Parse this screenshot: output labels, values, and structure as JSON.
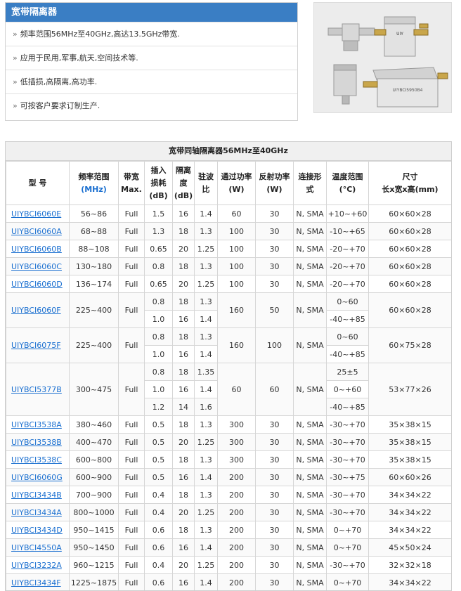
{
  "panel": {
    "title": "宽带隔离器",
    "features": [
      "频率范围56MHz至40GHz,高达13.5GHz带宽.",
      "应用于民用,军事,航天,空间技术等.",
      "低插损,高隔离,高功率.",
      "可按客户要求订制生产."
    ]
  },
  "table": {
    "title": "宽带同轴隔离器56MHz至40GHz",
    "headers": {
      "model": "型 号",
      "freq_a": "频率范围",
      "freq_b": "(MHz)",
      "bw_a": "带宽",
      "bw_b": "Max.",
      "il_a": "插入",
      "il_b": "损耗",
      "il_c": "(dB)",
      "iso_a": "隔离",
      "iso_b": "度",
      "iso_c": "(dB)",
      "vswr_a": "驻波",
      "vswr_b": "比",
      "fwd_a": "通过功率",
      "fwd_b": "(W)",
      "rev_a": "反射功率",
      "rev_b": "(W)",
      "conn_a": "连接形",
      "conn_b": "式",
      "temp_a": "温度范围",
      "temp_b": "(°C)",
      "size_a": "尺寸",
      "size_b": "长x宽x高(mm)"
    },
    "rows": [
      {
        "model": "UIYBCI6060E",
        "freq": "56~86",
        "bw": "Full",
        "il": "1.5",
        "iso": "16",
        "vswr": "1.4",
        "fwd": "60",
        "rev": "30",
        "conn": "N, SMA",
        "temp": "+10~+60",
        "size": "60×60×28"
      },
      {
        "model": "UIYBCI6060A",
        "freq": "68~88",
        "bw": "Full",
        "il": "1.3",
        "iso": "18",
        "vswr": "1.3",
        "fwd": "100",
        "rev": "30",
        "conn": "N, SMA",
        "temp": "-10~+65",
        "size": "60×60×28"
      },
      {
        "model": "UIYBCI6060B",
        "freq": "88~108",
        "bw": "Full",
        "il": "0.65",
        "iso": "20",
        "vswr": "1.25",
        "fwd": "100",
        "rev": "30",
        "conn": "N, SMA",
        "temp": "-20~+70",
        "size": "60×60×28"
      },
      {
        "model": "UIYBCI6060C",
        "freq": "130~180",
        "bw": "Full",
        "il": "0.8",
        "iso": "18",
        "vswr": "1.3",
        "fwd": "100",
        "rev": "30",
        "conn": "N, SMA",
        "temp": "-20~+70",
        "size": "60×60×28"
      },
      {
        "model": "UIYBCI6060D",
        "freq": "136~174",
        "bw": "Full",
        "il": "0.65",
        "iso": "20",
        "vswr": "1.25",
        "fwd": "100",
        "rev": "30",
        "conn": "N, SMA",
        "temp": "-20~+70",
        "size": "60×60×28"
      }
    ],
    "group_f": {
      "model": "UIYBCI6060F",
      "freq": "225~400",
      "bw": "Full",
      "fwd": "160",
      "rev": "50",
      "conn": "N, SMA",
      "size": "60×60×28",
      "sub": [
        {
          "il": "0.8",
          "iso": "18",
          "vswr": "1.3",
          "temp": "0~60"
        },
        {
          "il": "1.0",
          "iso": "16",
          "vswr": "1.4",
          "temp": "-40~+85"
        }
      ]
    },
    "group_7": {
      "model": "UIYBCI6075F",
      "freq": "225~400",
      "bw": "Full",
      "fwd": "160",
      "rev": "100",
      "conn": "N, SMA",
      "size": "60×75×28",
      "sub": [
        {
          "il": "0.8",
          "iso": "18",
          "vswr": "1.3",
          "temp": "0~60"
        },
        {
          "il": "1.0",
          "iso": "16",
          "vswr": "1.4",
          "temp": "-40~+85"
        }
      ]
    },
    "group_b": {
      "model": "UIYBCI5377B",
      "freq": "300~475",
      "bw": "Full",
      "fwd": "60",
      "rev": "60",
      "conn": "N, SMA",
      "size": "53×77×26",
      "sub": [
        {
          "il": "0.8",
          "iso": "18",
          "vswr": "1.35",
          "temp": "25±5"
        },
        {
          "il": "1.0",
          "iso": "16",
          "vswr": "1.4",
          "temp": "0~+60"
        },
        {
          "il": "1.2",
          "iso": "14",
          "vswr": "1.6",
          "temp": "-40~+85"
        }
      ]
    },
    "rows2": [
      {
        "model": "UIYBCI3538A",
        "freq": "380~460",
        "bw": "Full",
        "il": "0.5",
        "iso": "18",
        "vswr": "1.3",
        "fwd": "300",
        "rev": "30",
        "conn": "N, SMA",
        "temp": "-30~+70",
        "size": "35×38×15"
      },
      {
        "model": "UIYBCI3538B",
        "freq": "400~470",
        "bw": "Full",
        "il": "0.5",
        "iso": "20",
        "vswr": "1.25",
        "fwd": "300",
        "rev": "30",
        "conn": "N, SMA",
        "temp": "-30~+70",
        "size": "35×38×15"
      },
      {
        "model": "UIYBCI3538C",
        "freq": "600~800",
        "bw": "Full",
        "il": "0.5",
        "iso": "18",
        "vswr": "1.3",
        "fwd": "300",
        "rev": "30",
        "conn": "N, SMA",
        "temp": "-30~+70",
        "size": "35×38×15"
      },
      {
        "model": "UIYBCI6060G",
        "freq": "600~900",
        "bw": "Full",
        "il": "0.5",
        "iso": "16",
        "vswr": "1.4",
        "fwd": "200",
        "rev": "30",
        "conn": "N, SMA",
        "temp": "-30~+75",
        "size": "60×60×26"
      },
      {
        "model": "UIYBCI3434B",
        "freq": "700~900",
        "bw": "Full",
        "il": "0.4",
        "iso": "18",
        "vswr": "1.3",
        "fwd": "200",
        "rev": "30",
        "conn": "N, SMA",
        "temp": "-30~+70",
        "size": "34×34×22"
      },
      {
        "model": "UIYBCI3434A",
        "freq": "800~1000",
        "bw": "Full",
        "il": "0.4",
        "iso": "20",
        "vswr": "1.25",
        "fwd": "200",
        "rev": "30",
        "conn": "N, SMA",
        "temp": "-30~+70",
        "size": "34×34×22"
      },
      {
        "model": "UIYBCI3434D",
        "freq": "950~1415",
        "bw": "Full",
        "il": "0.6",
        "iso": "18",
        "vswr": "1.3",
        "fwd": "200",
        "rev": "30",
        "conn": "N, SMA",
        "temp": "0~+70",
        "size": "34×34×22"
      },
      {
        "model": "UIYBCI4550A",
        "freq": "950~1450",
        "bw": "Full",
        "il": "0.6",
        "iso": "16",
        "vswr": "1.4",
        "fwd": "200",
        "rev": "30",
        "conn": "N, SMA",
        "temp": "0~+70",
        "size": "45×50×24"
      },
      {
        "model": "UIYBCI3232A",
        "freq": "960~1215",
        "bw": "Full",
        "il": "0.4",
        "iso": "20",
        "vswr": "1.25",
        "fwd": "200",
        "rev": "30",
        "conn": "N, SMA",
        "temp": "-30~+70",
        "size": "32×32×18"
      },
      {
        "model": "UIYBCI3434F",
        "freq": "1225~1875",
        "bw": "Full",
        "il": "0.6",
        "iso": "16",
        "vswr": "1.4",
        "fwd": "200",
        "rev": "30",
        "conn": "N, SMA",
        "temp": "0~+70",
        "size": "34×34×22"
      }
    ]
  },
  "photo": {
    "label_top": "UIY",
    "label_big": "UIYBCI5950B4"
  }
}
